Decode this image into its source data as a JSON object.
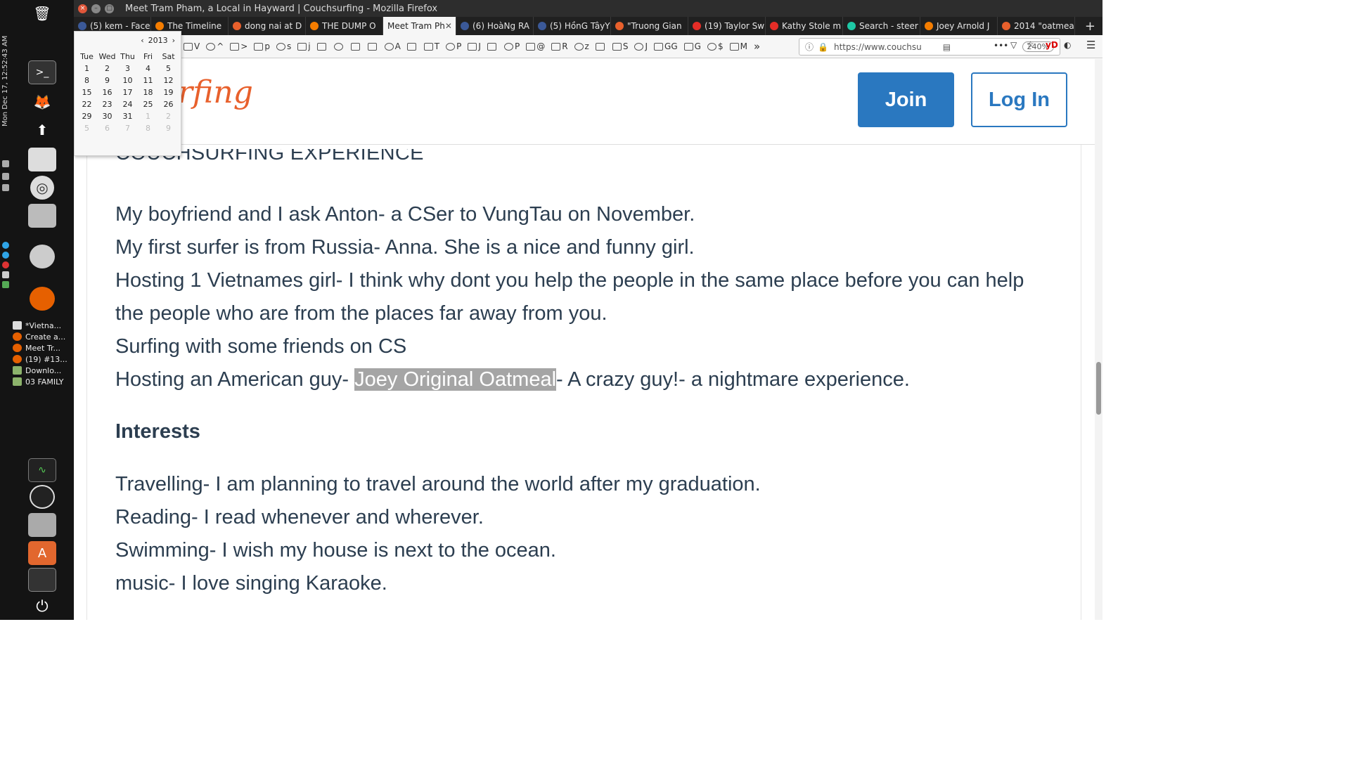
{
  "system": {
    "clock": "Mon Dec 17, 12:52:43 AM",
    "open_windows": [
      "*Vietna...",
      "Create a...",
      "Meet Tr...",
      "(19) #13...",
      "Downlo...",
      "03 FAMILY"
    ]
  },
  "window": {
    "title": "Meet Tram Pham, a Local in Hayward | Couchsurfing - Mozilla Firefox"
  },
  "tabs": [
    {
      "label": "(5) kem - Face",
      "color": "#3b5998"
    },
    {
      "label": "The Timeline",
      "color": "#f57d00"
    },
    {
      "label": "dong nai at D",
      "color": "#e8602c"
    },
    {
      "label": "THE DUMP O",
      "color": "#f57d00"
    },
    {
      "label": "Meet Tram Ph",
      "color": "#e8602c",
      "active": true
    },
    {
      "label": "(6) HoàNg RA",
      "color": "#3b5998"
    },
    {
      "label": "(5) HồnG TâyY",
      "color": "#3b5998"
    },
    {
      "label": "\"Truong Gian",
      "color": "#e8602c"
    },
    {
      "label": "(19) Taylor Sw",
      "color": "#e52d27"
    },
    {
      "label": "Kathy Stole m",
      "color": "#e52d27"
    },
    {
      "label": "Search - steer",
      "color": "#1ec8a5"
    },
    {
      "label": "Joey Arnold J",
      "color": "#f57d00"
    },
    {
      "label": "2014 \"oatmea",
      "color": "#e8602c"
    }
  ],
  "new_tab": "+",
  "bookmarks": [
    "V",
    "^",
    ">",
    "p",
    "s",
    "j",
    "",
    "",
    "",
    "",
    "A",
    "",
    "T",
    "P",
    "J",
    "",
    "P",
    "@",
    "R",
    "z",
    "",
    "S",
    "J",
    "GG",
    "G",
    "$",
    "M"
  ],
  "bookmarks_overflow": "»",
  "url": "https://www.couchsu",
  "zoom": "240%",
  "calendar": {
    "year": "2013",
    "days": [
      "Tue",
      "Wed",
      "Thu",
      "Fri",
      "Sat"
    ],
    "weeks": [
      [
        "1",
        "2",
        "3",
        "4",
        "5"
      ],
      [
        "8",
        "9",
        "10",
        "11",
        "12"
      ],
      [
        "15",
        "16",
        "17",
        "18",
        "19"
      ],
      [
        "22",
        "23",
        "24",
        "25",
        "26"
      ],
      [
        "29",
        "30",
        "31",
        "1",
        "2"
      ],
      [
        "5",
        "6",
        "7",
        "8",
        "9"
      ]
    ]
  },
  "site": {
    "logo": "rfing",
    "join": "Join",
    "login": "Log In",
    "section_title": "COUCHSURFING EXPERIENCE",
    "experience": [
      "My boyfriend and I ask Anton- a CSer to VungTau on November.",
      "My first surfer is from Russia- Anna. She is a nice and funny girl.",
      "Hosting 1 Vietnames girl- I think why dont you help the people in the same place before you can help the people who are from the places far away from you.",
      "Surfing with some friends on CS"
    ],
    "last_line": {
      "before": "Hosting an American guy- ",
      "highlight": "Joey Original Oatmeal",
      "after": "- A crazy guy!- a nightmare experience."
    },
    "interests_title": "Interests",
    "interests": [
      "Travelling- I am planning to travel around the world after my graduation.",
      "Reading- I read whenever and wherever.",
      "Swimming- I wish my house is next to the ocean.",
      "music- I love singing Karaoke."
    ]
  }
}
